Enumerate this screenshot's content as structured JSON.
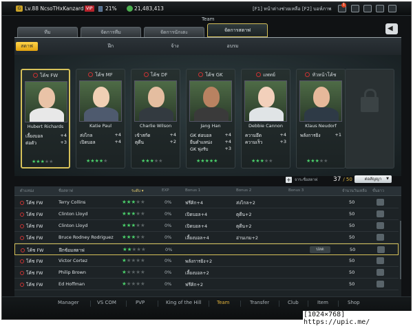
{
  "topbar": {
    "level": "Lv.88",
    "player": "NcsoTHxKanzard",
    "vip": "VIP",
    "exp": "21%",
    "coins": "21,483,413",
    "help": "[F1] หน้าต่างช่วยเหลือ [F2] บอห์ภาพ",
    "notif_count": "1"
  },
  "team_label": "Team",
  "main_tabs": [
    "ทีม",
    "จัดการทีม",
    "จัดการนักเตะ",
    "จัดการสตาฟ"
  ],
  "sub_tabs": [
    "สตาฟ",
    "ฝึก",
    "จ้าง",
    "อบรม"
  ],
  "staff": [
    {
      "role": "โค้ช FW",
      "name": "Hubert Richards",
      "attrs": [
        [
          "เลี้ยงบอล",
          "+4"
        ],
        [
          "ต่อตัว",
          "+3"
        ]
      ],
      "stars": 3,
      "skin": "#e9c3a7",
      "shirt": "#e8e8e8"
    },
    {
      "role": "โค้ช MF",
      "name": "Katie Paul",
      "attrs": [
        [
          "ส่งไกล",
          "+4"
        ],
        [
          "เปิดบอล",
          "+4"
        ]
      ],
      "stars": 4,
      "skin": "#f0cfb4",
      "shirt": "#4e5a6e"
    },
    {
      "role": "โค้ช DF",
      "name": "Charlie Wilson",
      "attrs": [
        [
          "เข้าสกัด",
          "+4"
        ],
        [
          "ตุดืน",
          "+2"
        ]
      ],
      "stars": 3,
      "skin": "#e4bda0",
      "shirt": "#333a40"
    },
    {
      "role": "โค้ช GK",
      "name": "Jang Han",
      "attrs": [
        [
          "GK ต่อบอล",
          "+4"
        ],
        [
          "ยืนตำแหน่ง",
          "+4"
        ],
        [
          "GK พุ่งรับ",
          "+3"
        ]
      ],
      "stars": 5,
      "skin": "#b98261",
      "shirt": "#3a3a3a"
    },
    {
      "role": "แพทย์",
      "name": "Debbie Cannon",
      "attrs": [
        [
          "ความอึด",
          "+4"
        ],
        [
          "ความเร็ว",
          "+3"
        ]
      ],
      "stars": 3,
      "skin": "#f2d0bb",
      "shirt": "#e0e4e6"
    },
    {
      "role": "หัวหน้าโค้ช",
      "name": "Klaus Neudorf",
      "attrs": [
        [
          "พลังการยิง",
          "+1"
        ]
      ],
      "stars": 3,
      "skin": "#e6b89a",
      "shirt": "#2e3a46"
    }
  ],
  "sort_label": "จาระชื่อสตาฟ",
  "count": {
    "current": "37",
    "max": "/ 50"
  },
  "contract_label": "ต่อสัญญา",
  "table_headers": [
    "ตำแหน่ง",
    "ชื่อสตาฟ",
    "ระดับ",
    "EXP",
    "Bonus 1",
    "Bonus 2",
    "Bonus 3",
    "จำนวนวันเหลือ",
    "ขั้นยาว"
  ],
  "rows": [
    {
      "pos": "โค้ช FW",
      "name": "Terry Collins",
      "stars": 3,
      "exp": "0%",
      "b1": "ฟรีคิก+4",
      "b2": "ส่งไกล+2",
      "b3": "",
      "days": "50"
    },
    {
      "pos": "โค้ช FW",
      "name": "Clinton Lloyd",
      "stars": 3,
      "exp": "0%",
      "b1": "เปิดบอล+4",
      "b2": "ตุดืน+2",
      "b3": "",
      "days": "50"
    },
    {
      "pos": "โค้ช FW",
      "name": "Clinton Lloyd",
      "stars": 3,
      "exp": "0%",
      "b1": "เปิดบอล+4",
      "b2": "ตุดืน+2",
      "b3": "",
      "days": "50"
    },
    {
      "pos": "โค้ช FW",
      "name": "Bruce Rodney Rodriguez",
      "stars": 3,
      "exp": "0%",
      "b1": "เลี้ยงบอล+4",
      "b2": "อ่านเกม+2",
      "b3": "",
      "days": "50"
    },
    {
      "pos": "โค้ช FW",
      "name": "ฝึกซ้อมสตาฟ",
      "stars": 2,
      "exp": "0%",
      "b1": "",
      "b2": "",
      "b3": "ปลด",
      "days": "50"
    },
    {
      "pos": "โค้ช FW",
      "name": "Victor Cortez",
      "stars": 1,
      "exp": "0%",
      "b1": "พลังการยิง+2",
      "b2": "",
      "b3": "",
      "days": "50"
    },
    {
      "pos": "โค้ช FW",
      "name": "Philip Brown",
      "stars": 1,
      "exp": "0%",
      "b1": "เลี้ยงบอล+2",
      "b2": "",
      "b3": "",
      "days": "50"
    },
    {
      "pos": "โค้ช FW",
      "name": "Ed Hoffman",
      "stars": 1,
      "exp": "0%",
      "b1": "ฟรีคิก+2",
      "b2": "",
      "b3": "",
      "days": "50"
    }
  ],
  "bottom_nav": [
    "Manager",
    "VS COM",
    "PVP",
    "King of the Hill",
    "Team",
    "Transfer",
    "Club",
    "Item",
    "Shop"
  ],
  "colors": {
    "accent": "#e5b53c",
    "star_on": "#4bd06b",
    "frame": "#d7c25a"
  },
  "watermark": "[1024×768] https://upic.me/"
}
